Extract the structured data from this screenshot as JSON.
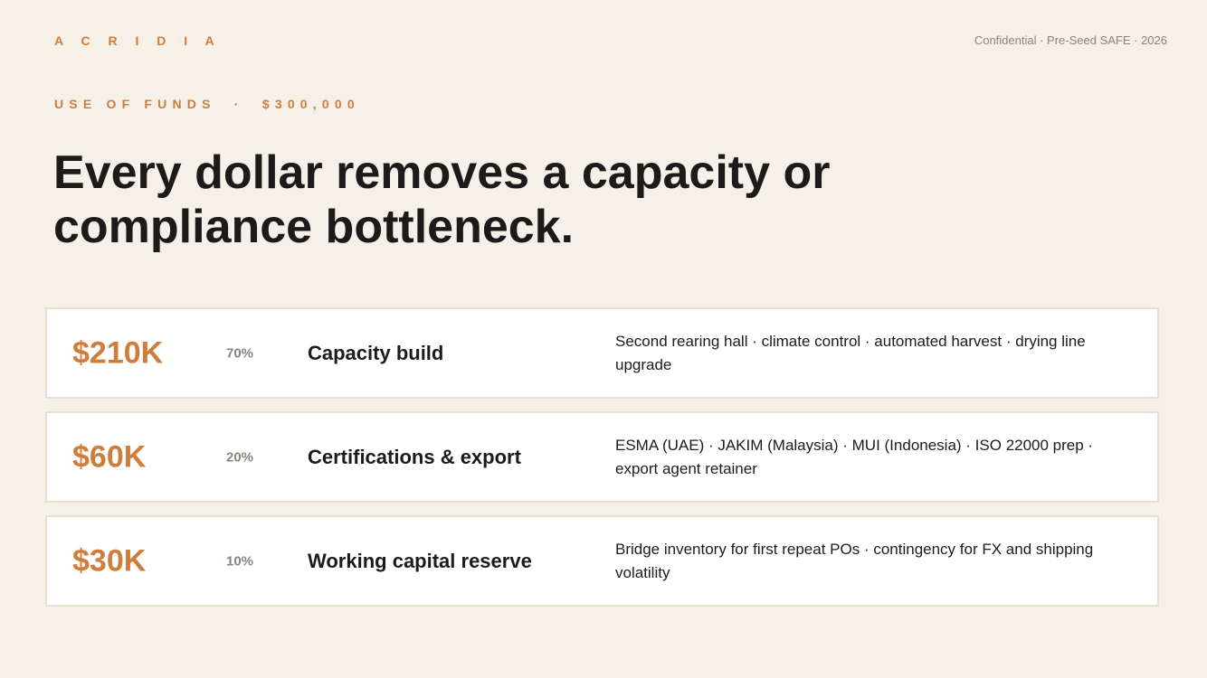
{
  "brand": "A C R I D I A",
  "confidential": "Confidential · Pre-Seed SAFE · 2026",
  "eyebrow": "USE OF FUNDS  ·  $300,000",
  "headline": "Every dollar removes a capacity or compliance bottleneck.",
  "colors": {
    "background": "#f5f0e8",
    "accent": "#cf7d3b",
    "text": "#1c1b19",
    "muted": "#8a857c",
    "card": "#ffffff",
    "card_border": "#e7e0d3"
  },
  "rows": [
    {
      "amount": "$210K",
      "percent": "70%",
      "title": "Capacity build",
      "description": "Second rearing hall · climate control · automated harvest · drying line upgrade"
    },
    {
      "amount": "$60K",
      "percent": "20%",
      "title": "Certifications & export",
      "description": "ESMA (UAE) · JAKIM (Malaysia) · MUI (Indonesia) · ISO 22000 prep · export agent retainer"
    },
    {
      "amount": "$30K",
      "percent": "10%",
      "title": "Working capital reserve",
      "description": "Bridge inventory for first repeat POs · contingency for FX and shipping volatility"
    }
  ]
}
